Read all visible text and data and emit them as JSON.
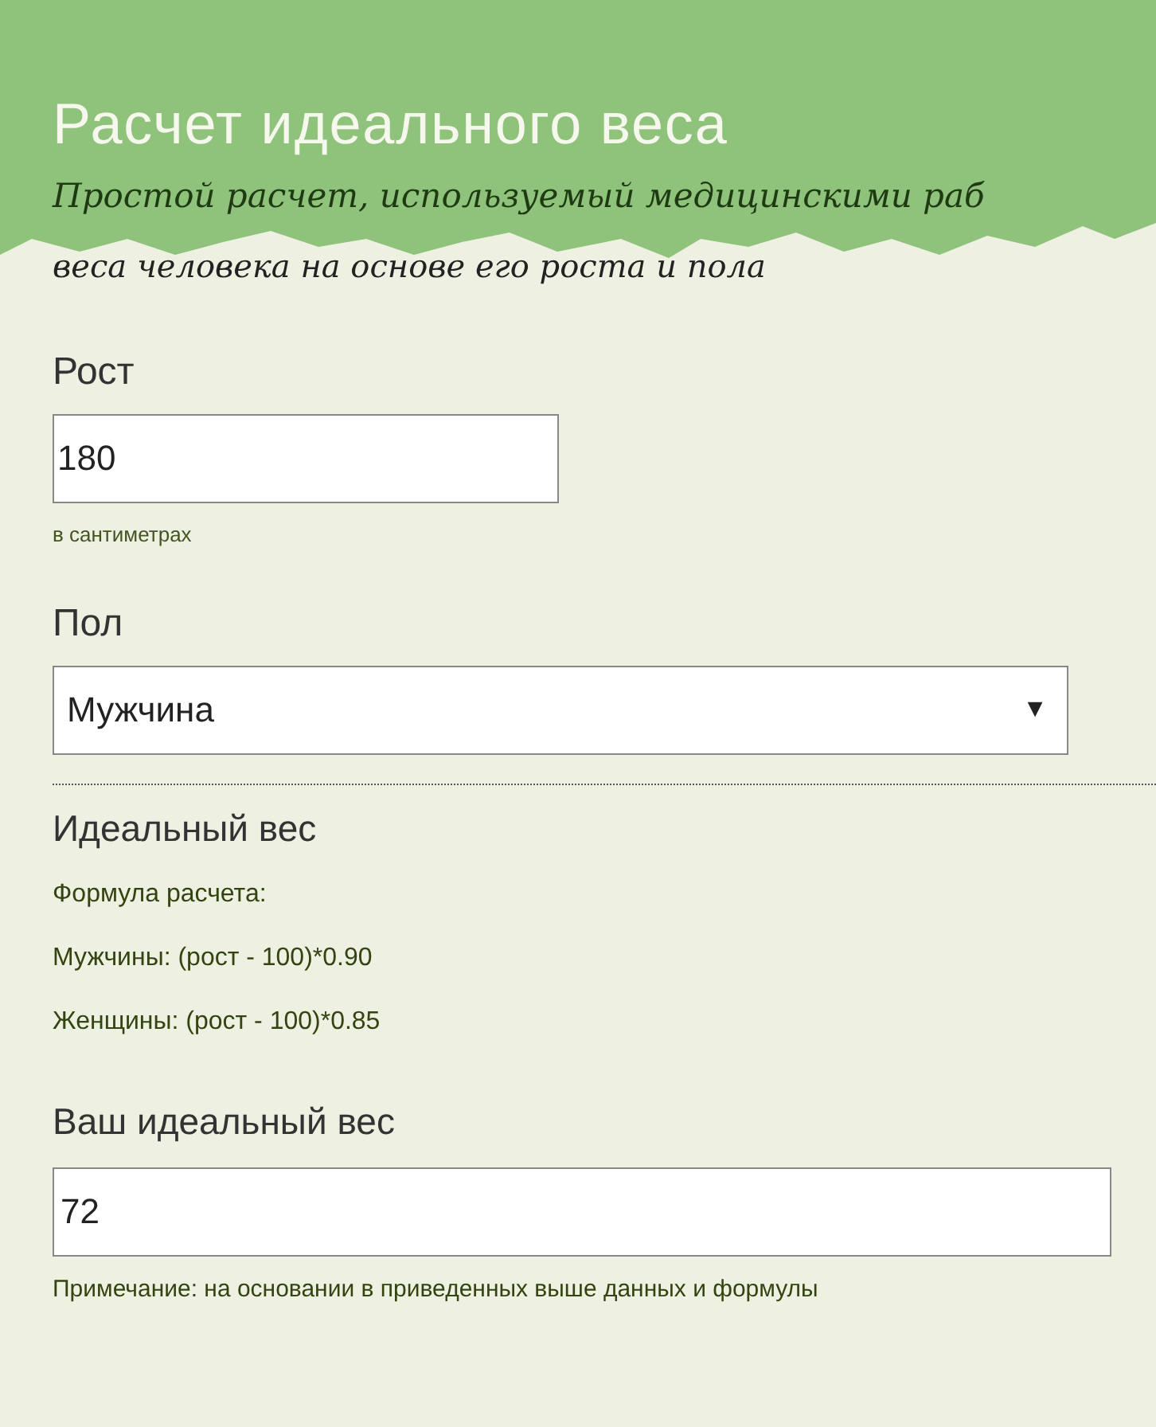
{
  "header": {
    "title": "Расчет идеального веса",
    "subtitle_line_1": "Простой расчет, используемый медицинскими раб",
    "subtitle_line_2": "веса человека на основе его роста и пола"
  },
  "fields": [
    {
      "kind": "input",
      "label": "Рост",
      "value": "180",
      "hint": "в сантиметрах"
    },
    {
      "kind": "select",
      "label": "Пол",
      "value": "Мужчина",
      "arrow": "▼"
    }
  ],
  "result": {
    "heading": "Идеальный вес",
    "formula_lines": [
      "Формула расчета:",
      "Мужчины: (рост - 100)*0.90",
      "Женщины: (рост - 100)*0.85"
    ],
    "label": "Ваш идеальный вес",
    "value": "72",
    "note": "Примечание: на основании в приведенных выше данных и формулы"
  }
}
